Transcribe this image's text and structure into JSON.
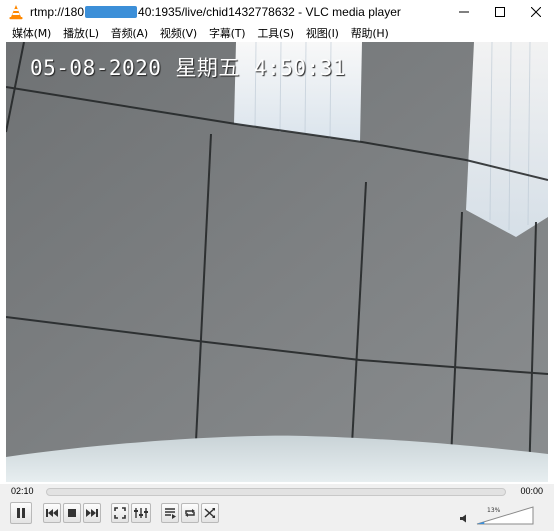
{
  "window": {
    "title_prefix": "rtmp://180",
    "title_suffix": "40:1935/live/chid1432778632 - VLC media player",
    "minimize_icon": "minimize-icon",
    "maximize_icon": "maximize-icon",
    "close_icon": "close-icon"
  },
  "menu": [
    {
      "label": "媒体(M)"
    },
    {
      "label": "播放(L)"
    },
    {
      "label": "音频(A)"
    },
    {
      "label": "视频(V)"
    },
    {
      "label": "字幕(T)"
    },
    {
      "label": "工具(S)"
    },
    {
      "label": "视图(I)"
    },
    {
      "label": "帮助(H)"
    }
  ],
  "video": {
    "osd_date": "05-08-2020",
    "osd_weekday": "星期五",
    "osd_time": "4:50:31"
  },
  "playback": {
    "elapsed": "02:10",
    "total": "00:00",
    "seek_fraction": 0
  },
  "controls": [
    {
      "name": "pause-button",
      "icon": "pause-icon"
    },
    {
      "name": "previous-button",
      "icon": "previous-icon"
    },
    {
      "name": "stop-button",
      "icon": "stop-icon"
    },
    {
      "name": "next-button",
      "icon": "next-icon"
    },
    {
      "name": "fullscreen-button",
      "icon": "fullscreen-icon"
    },
    {
      "name": "extended-settings-button",
      "icon": "equalizer-icon"
    },
    {
      "name": "playlist-button",
      "icon": "playlist-icon"
    },
    {
      "name": "loop-button",
      "icon": "loop-icon"
    },
    {
      "name": "shuffle-button",
      "icon": "shuffle-icon"
    }
  ],
  "volume": {
    "label": "13%",
    "level": 0.13,
    "icon": "speaker-icon"
  },
  "colors": {
    "vlc_orange": "#ff8800",
    "title_redaction": "#3c8fd8",
    "control_bg": "#f0f0f0"
  }
}
